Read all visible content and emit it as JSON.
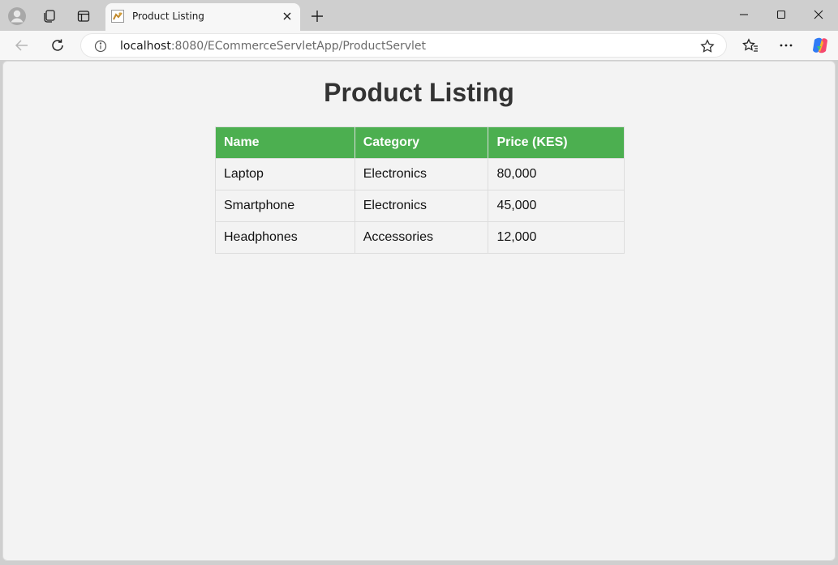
{
  "browser": {
    "tab_title": "Product Listing",
    "url_host": "localhost",
    "url_rest": ":8080/ECommerceServletApp/ProductServlet"
  },
  "page": {
    "heading": "Product Listing",
    "table": {
      "headers": [
        "Name",
        "Category",
        "Price (KES)"
      ],
      "rows": [
        [
          "Laptop",
          "Electronics",
          "80,000"
        ],
        [
          "Smartphone",
          "Electronics",
          "45,000"
        ],
        [
          "Headphones",
          "Accessories",
          "12,000"
        ]
      ]
    }
  },
  "colors": {
    "header_bg": "#4caf50",
    "page_bg": "#f3f3f3"
  }
}
